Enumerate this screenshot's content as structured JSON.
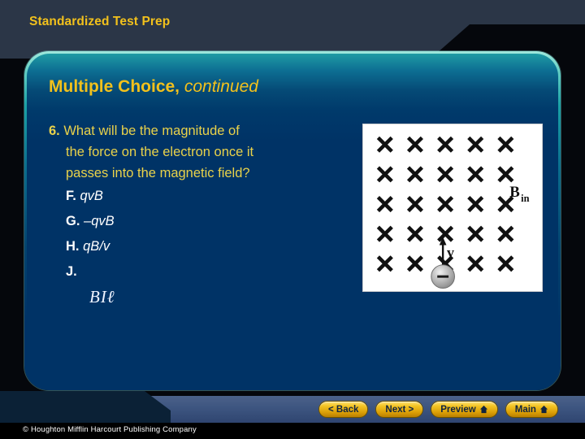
{
  "header": {
    "title": "Standardized Test Prep"
  },
  "panel": {
    "title_bold": "Multiple Choice,",
    "title_italic": " continued"
  },
  "question": {
    "number": "6.",
    "lines": [
      "What will be the magnitude of",
      "the force on the electron once it",
      "passes into the magnetic field?"
    ],
    "choices": [
      {
        "letter": "F.",
        "expr": "qvB"
      },
      {
        "letter": "G.",
        "expr": "–qvB"
      },
      {
        "letter": "H.",
        "expr": "qB/v"
      },
      {
        "letter": "J.",
        "expr": ""
      }
    ],
    "choice_j_formula": "BIℓ"
  },
  "figure": {
    "name": "magnetic-field-diagram",
    "field_symbol": "×",
    "field_rows": 5,
    "field_cols": 5,
    "field_label_main": "B",
    "field_label_sub": "in",
    "velocity_label": "v",
    "charge_sign": "–",
    "charge_description": "electron"
  },
  "nav": {
    "buttons": [
      {
        "label": "< Back",
        "icon": "",
        "name": "back-button"
      },
      {
        "label": "Next >",
        "icon": "",
        "name": "next-button"
      },
      {
        "label": "Preview",
        "icon": "home-icon",
        "name": "preview-button"
      },
      {
        "label": "Main",
        "icon": "home-icon",
        "name": "main-button"
      }
    ]
  },
  "footer": {
    "copyright": "© Houghton Mifflin Harcourt Publishing Company"
  },
  "colors": {
    "accent_yellow": "#f2c11c",
    "panel_navy": "#003366",
    "panel_border_teal": "#63cfc4",
    "header_slate": "#2b3647",
    "nav_bar_blue": "#3d5580",
    "button_gold": "#f3c524"
  }
}
